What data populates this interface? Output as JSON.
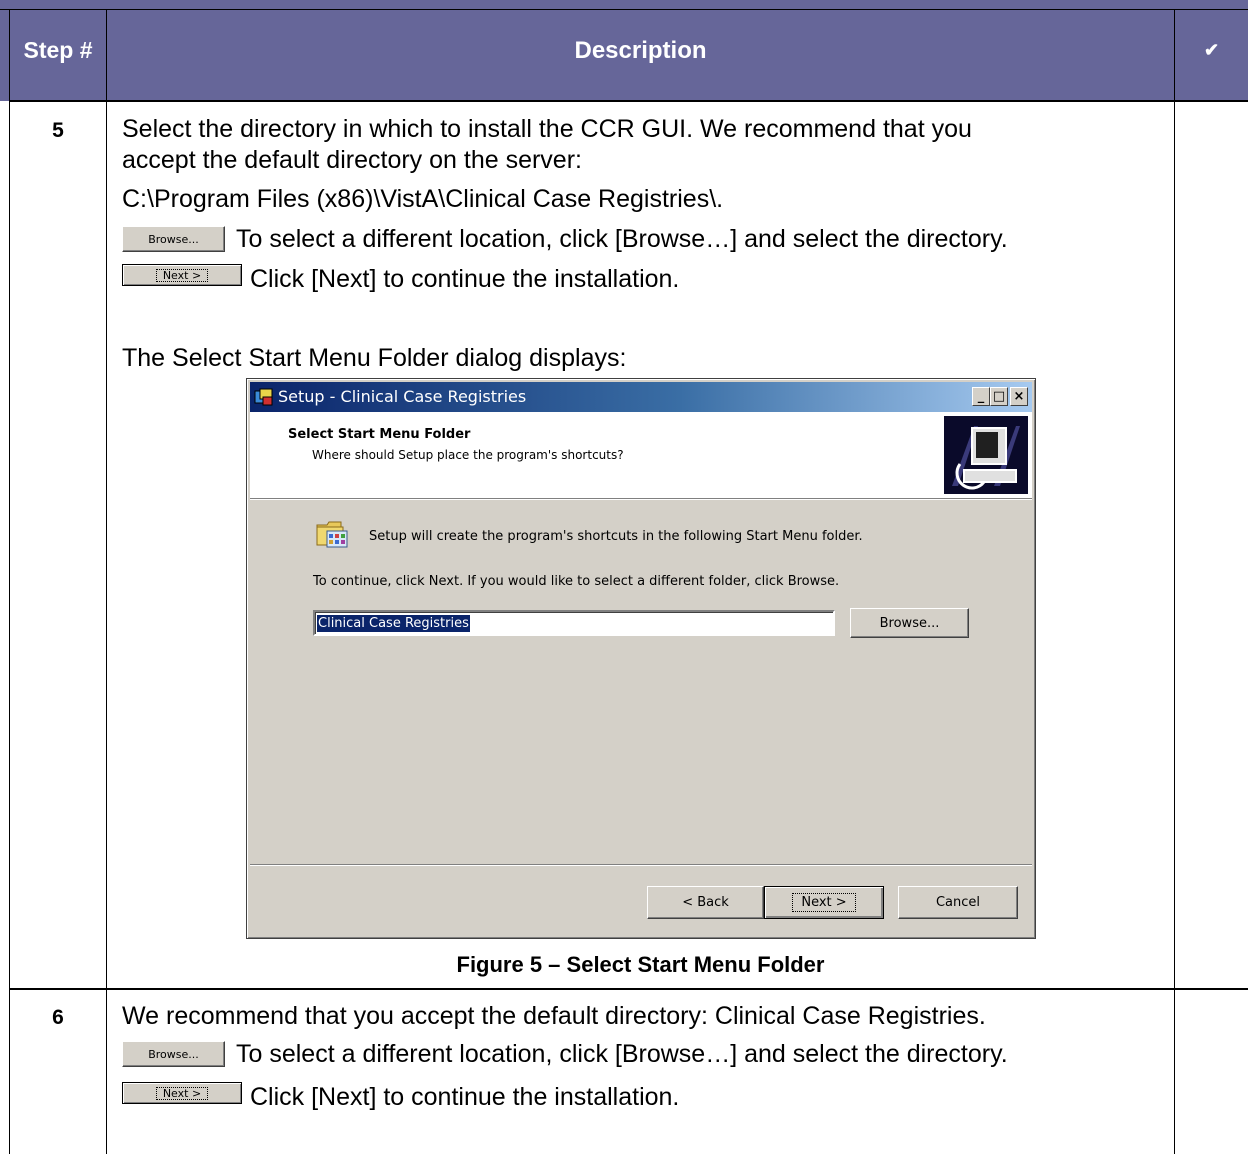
{
  "table": {
    "headers": {
      "step": "Step #",
      "description": "Description",
      "check": "✔"
    },
    "rows": [
      {
        "step": "5",
        "lines": [
          "Select the directory in which to install the CCR GUI. We recommend that you",
          "accept the default directory on the server:",
          "C:\\Program Files (x86)\\VistA\\Clinical Case Registries\\.",
          "To select a different location, click [Browse…] and select the directory.",
          "Click [Next] to continue the installation.",
          "The Select Start Menu Folder dialog displays:"
        ],
        "browse_button": "Browse...",
        "next_button": "Next >",
        "caption": "Figure 5 – Select Start Menu Folder"
      },
      {
        "step": "6",
        "lines": [
          "We recommend that you accept the default directory: Clinical Case Registries.",
          "To select a different location, click [Browse…] and select the directory.",
          "Click [Next] to continue the installation."
        ],
        "browse_button": "Browse...",
        "next_button": "Next >"
      }
    ]
  },
  "dialog": {
    "title": "Setup - Clinical Case Registries",
    "min_glyph": "_",
    "max_glyph": "□",
    "close_glyph": "×",
    "header_title": "Select Start Menu Folder",
    "header_subtitle": "Where should Setup place the program's shortcuts?",
    "info_text": "Setup will create the program's shortcuts in the following Start Menu folder.",
    "continue_text": "To continue, click Next. If you would like to select a different folder, click Browse.",
    "folder_value": "Clinical Case Registries",
    "browse_label": "Browse...",
    "back_label": "< Back",
    "next_label": "Next >",
    "cancel_label": "Cancel"
  },
  "colors": {
    "header_bg": "#666699",
    "titlebar": "#0a246a",
    "dialog_bg": "#d4d0c8"
  }
}
